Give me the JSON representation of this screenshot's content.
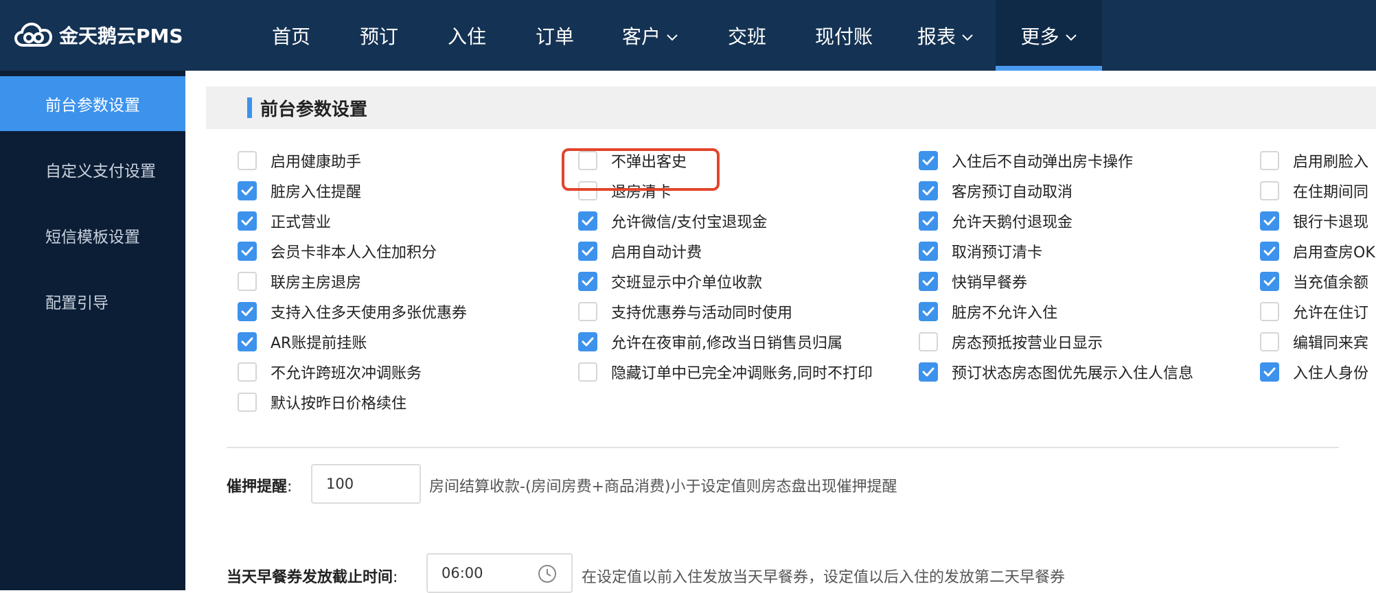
{
  "brand": {
    "logo_text": "金天鹅云PMS"
  },
  "nav": {
    "items": [
      {
        "label": "首页",
        "dropdown": false
      },
      {
        "label": "预订",
        "dropdown": false
      },
      {
        "label": "入住",
        "dropdown": false
      },
      {
        "label": "订单",
        "dropdown": false
      },
      {
        "label": "客户",
        "dropdown": true
      },
      {
        "label": "交班",
        "dropdown": false
      },
      {
        "label": "现付账",
        "dropdown": false
      },
      {
        "label": "报表",
        "dropdown": true
      },
      {
        "label": "更多",
        "dropdown": true,
        "active": true
      }
    ]
  },
  "sidebar": {
    "items": [
      {
        "label": "前台参数设置",
        "active": true
      },
      {
        "label": "自定义支付设置"
      },
      {
        "label": "短信模板设置"
      },
      {
        "label": "配置引导"
      }
    ]
  },
  "section": {
    "title": "前台参数设置"
  },
  "options": {
    "col1": [
      {
        "label": "启用健康助手",
        "checked": false
      },
      {
        "label": "脏房入住提醒",
        "checked": true
      },
      {
        "label": "正式营业",
        "checked": true
      },
      {
        "label": "会员卡非本人入住加积分",
        "checked": true
      },
      {
        "label": "联房主房退房",
        "checked": false
      },
      {
        "label": "支持入住多天使用多张优惠券",
        "checked": true
      },
      {
        "label": "AR账提前挂账",
        "checked": true
      },
      {
        "label": "不允许跨班次冲调账务",
        "checked": false
      },
      {
        "label": "默认按昨日价格续住",
        "checked": false
      }
    ],
    "col2": [
      {
        "label": "不弹出客史",
        "checked": false
      },
      {
        "label": "退房清卡",
        "checked": false
      },
      {
        "label": "允许微信/支付宝退现金",
        "checked": true
      },
      {
        "label": "启用自动计费",
        "checked": true
      },
      {
        "label": "交班显示中介单位收款",
        "checked": true
      },
      {
        "label": "支持优惠券与活动同时使用",
        "checked": false
      },
      {
        "label": "允许在夜审前,修改当日销售员归属",
        "checked": true
      },
      {
        "label": "隐藏订单中已完全冲调账务,同时不打印",
        "checked": false
      }
    ],
    "col3": [
      {
        "label": "入住后不自动弹出房卡操作",
        "checked": true
      },
      {
        "label": "客房预订自动取消",
        "checked": true
      },
      {
        "label": "允许天鹅付退现金",
        "checked": true
      },
      {
        "label": "取消预订清卡",
        "checked": true
      },
      {
        "label": "快销早餐券",
        "checked": true
      },
      {
        "label": "脏房不允许入住",
        "checked": true
      },
      {
        "label": "房态预抵按营业日显示",
        "checked": false
      },
      {
        "label": "预订状态房态图优先展示入住人信息",
        "checked": true
      }
    ],
    "col4": [
      {
        "label": "启用刷脸入",
        "checked": false
      },
      {
        "label": "在住期间同",
        "checked": false
      },
      {
        "label": "银行卡退现",
        "checked": true
      },
      {
        "label": "启用查房OK",
        "checked": true
      },
      {
        "label": "当充值余额",
        "checked": true
      },
      {
        "label": "允许在住订",
        "checked": false
      },
      {
        "label": "编辑同来宾",
        "checked": false
      },
      {
        "label": "入住人身份",
        "checked": true
      }
    ]
  },
  "deposit_reminder": {
    "label": "催押提醒",
    "colon": ":",
    "value": "100",
    "hint": "房间结算收款-(房间房费+商品消费)小于设定值则房态盘出现催押提醒"
  },
  "breakfast_cutoff": {
    "label": "当天早餐券发放截止时间",
    "colon": ":",
    "value": "06:00",
    "hint": "在设定值以前入住发放当天早餐券，设定值以后入住的发放第二天早餐券"
  },
  "colors": {
    "topbar": "#143253",
    "sidebar": "#0c1e36",
    "accent": "#3d92ec",
    "highlight": "#e2452c"
  }
}
